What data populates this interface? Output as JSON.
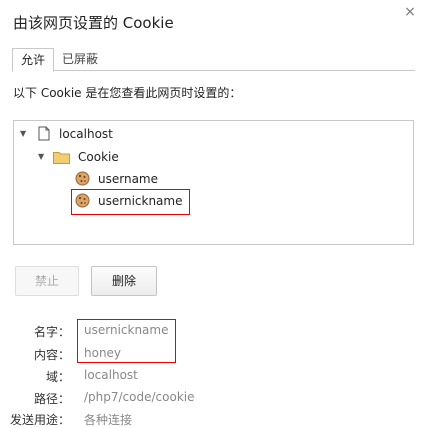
{
  "dialog": {
    "title": "由该网页设置的 Cookie",
    "close_glyph": "×"
  },
  "tabs": [
    {
      "label": "允许"
    },
    {
      "label": "已屏蔽"
    }
  ],
  "intro_text": "以下 Cookie 是在您查看此网页时设置的：",
  "tree": {
    "host": "localhost",
    "folder": "Cookie",
    "cookies": [
      {
        "name": "username"
      },
      {
        "name": "usernickname"
      }
    ]
  },
  "buttons": {
    "block": "禁止",
    "delete": "删除"
  },
  "details": [
    {
      "label": "名字：",
      "value": "usernickname"
    },
    {
      "label": "内容：",
      "value": "honey"
    },
    {
      "label": "域：",
      "value": "localhost"
    },
    {
      "label": "路径：",
      "value": "/php7/code/cookie"
    },
    {
      "label": "发送用途：",
      "value": "各种连接"
    }
  ],
  "colors": {
    "highlight": "#e00000",
    "folder": "#f0c060",
    "cookie": "#c8864a"
  }
}
